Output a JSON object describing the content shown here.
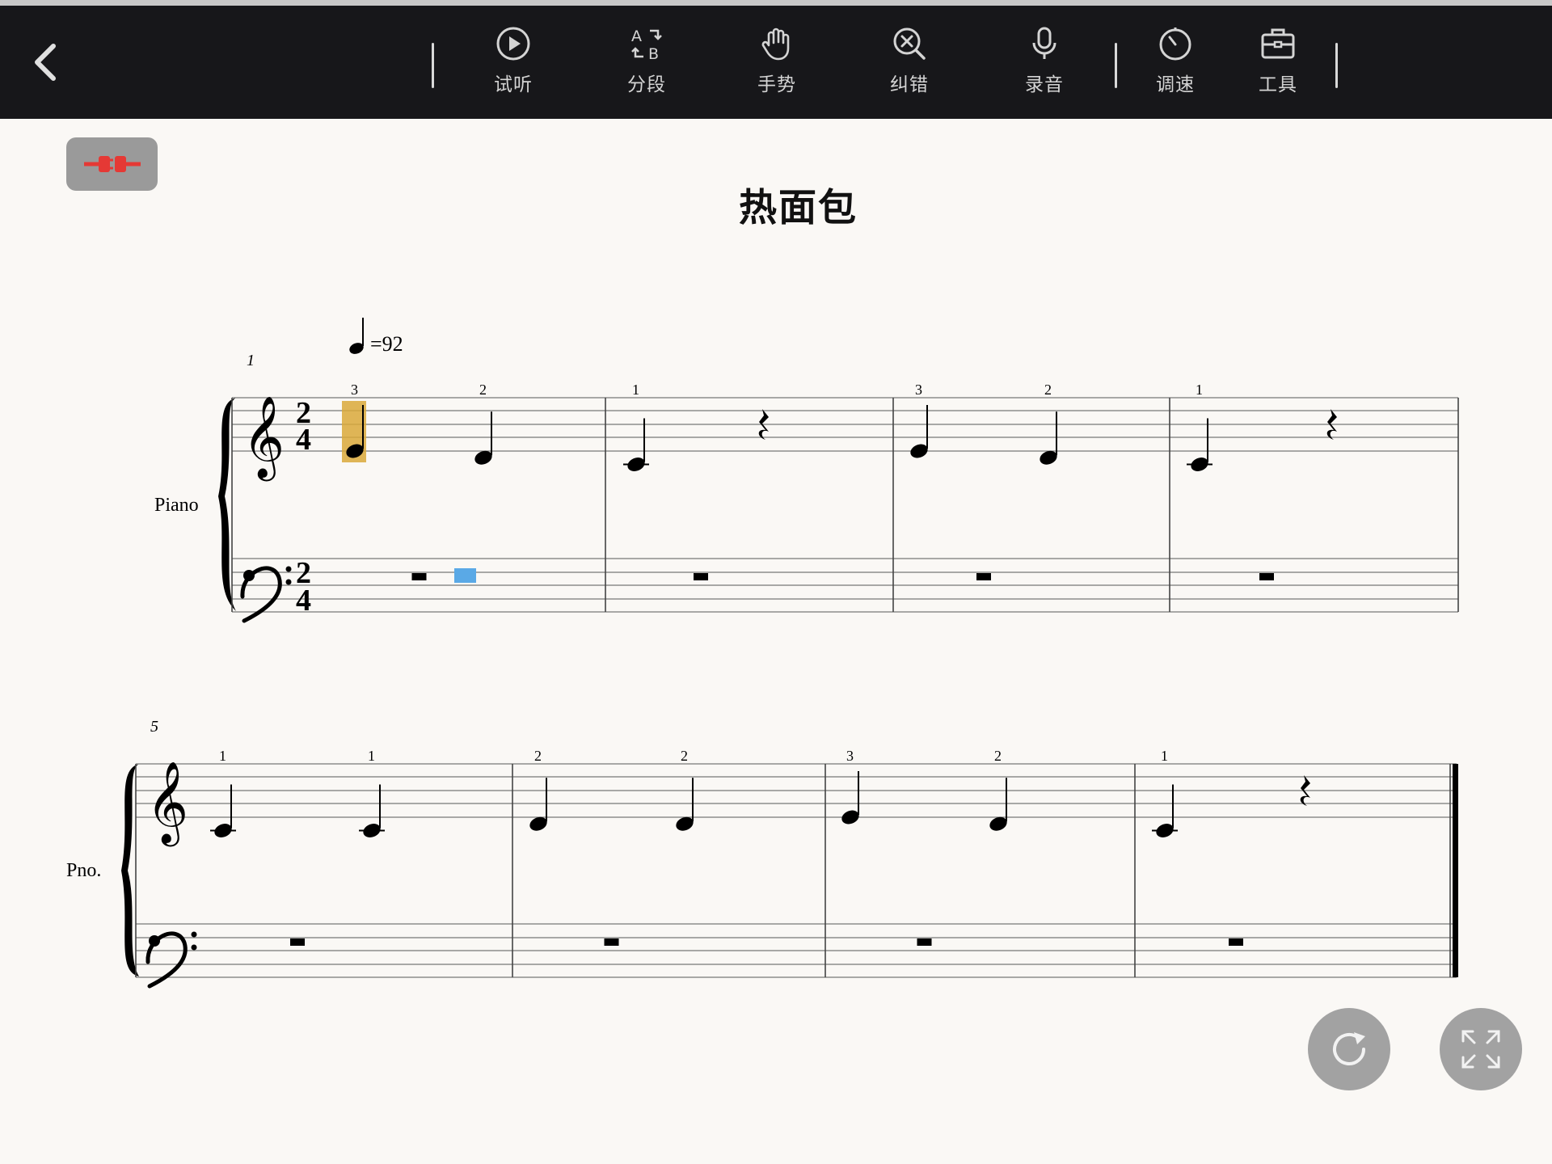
{
  "toolbar": {
    "back_label": "",
    "tools": [
      {
        "id": "audition",
        "icon": "play-circle-icon",
        "label": "试听"
      },
      {
        "id": "segment",
        "icon": "ab-segment-icon",
        "label": "分段"
      },
      {
        "id": "gesture",
        "icon": "hand-icon",
        "label": "手势"
      },
      {
        "id": "correct",
        "icon": "zoom-x-icon",
        "label": "纠错"
      },
      {
        "id": "record",
        "icon": "microphone-icon",
        "label": "录音"
      },
      {
        "id": "speed",
        "icon": "timer-icon",
        "label": "调速"
      },
      {
        "id": "tools",
        "icon": "toolbox-icon",
        "label": "工具"
      }
    ]
  },
  "connect_button": {
    "icon": "plug-disconnected-icon",
    "color": "#e53935"
  },
  "score": {
    "title": "热面包",
    "tempo": {
      "note": "quarter",
      "text": "=92"
    },
    "systems": [
      {
        "measure_start": "1",
        "instrument": "Piano",
        "time_signature": [
          "2",
          "4"
        ],
        "measures": [
          {
            "treble": [
              {
                "pitch": "E4",
                "finger": "3"
              },
              {
                "pitch": "D4",
                "finger": "2"
              }
            ],
            "bass": "rest"
          },
          {
            "treble": [
              {
                "pitch": "C4",
                "finger": "1"
              },
              {
                "rest": "quarter"
              }
            ],
            "bass": "rest"
          },
          {
            "treble": [
              {
                "pitch": "E4",
                "finger": "3"
              },
              {
                "pitch": "D4",
                "finger": "2"
              }
            ],
            "bass": "rest"
          },
          {
            "treble": [
              {
                "pitch": "C4",
                "finger": "1"
              },
              {
                "rest": "quarter"
              }
            ],
            "bass": "rest"
          }
        ]
      },
      {
        "measure_start": "5",
        "instrument": "Pno.",
        "measures": [
          {
            "treble": [
              {
                "pitch": "C4",
                "finger": "1"
              },
              {
                "pitch": "C4",
                "finger": "1"
              }
            ],
            "bass": "rest"
          },
          {
            "treble": [
              {
                "pitch": "D4",
                "finger": "2"
              },
              {
                "pitch": "D4",
                "finger": "2"
              }
            ],
            "bass": "rest"
          },
          {
            "treble": [
              {
                "pitch": "E4",
                "finger": "3"
              },
              {
                "pitch": "D4",
                "finger": "2"
              }
            ],
            "bass": "rest"
          },
          {
            "treble": [
              {
                "pitch": "C4",
                "finger": "1"
              },
              {
                "rest": "quarter"
              }
            ],
            "bass": "rest"
          }
        ]
      }
    ],
    "current_note_highlight": "#d9a93a",
    "current_rest_highlight": "#5aa9e6"
  },
  "fabs": [
    {
      "id": "restart",
      "icon": "refresh-icon"
    },
    {
      "id": "fullscreen",
      "icon": "fullscreen-icon"
    }
  ]
}
